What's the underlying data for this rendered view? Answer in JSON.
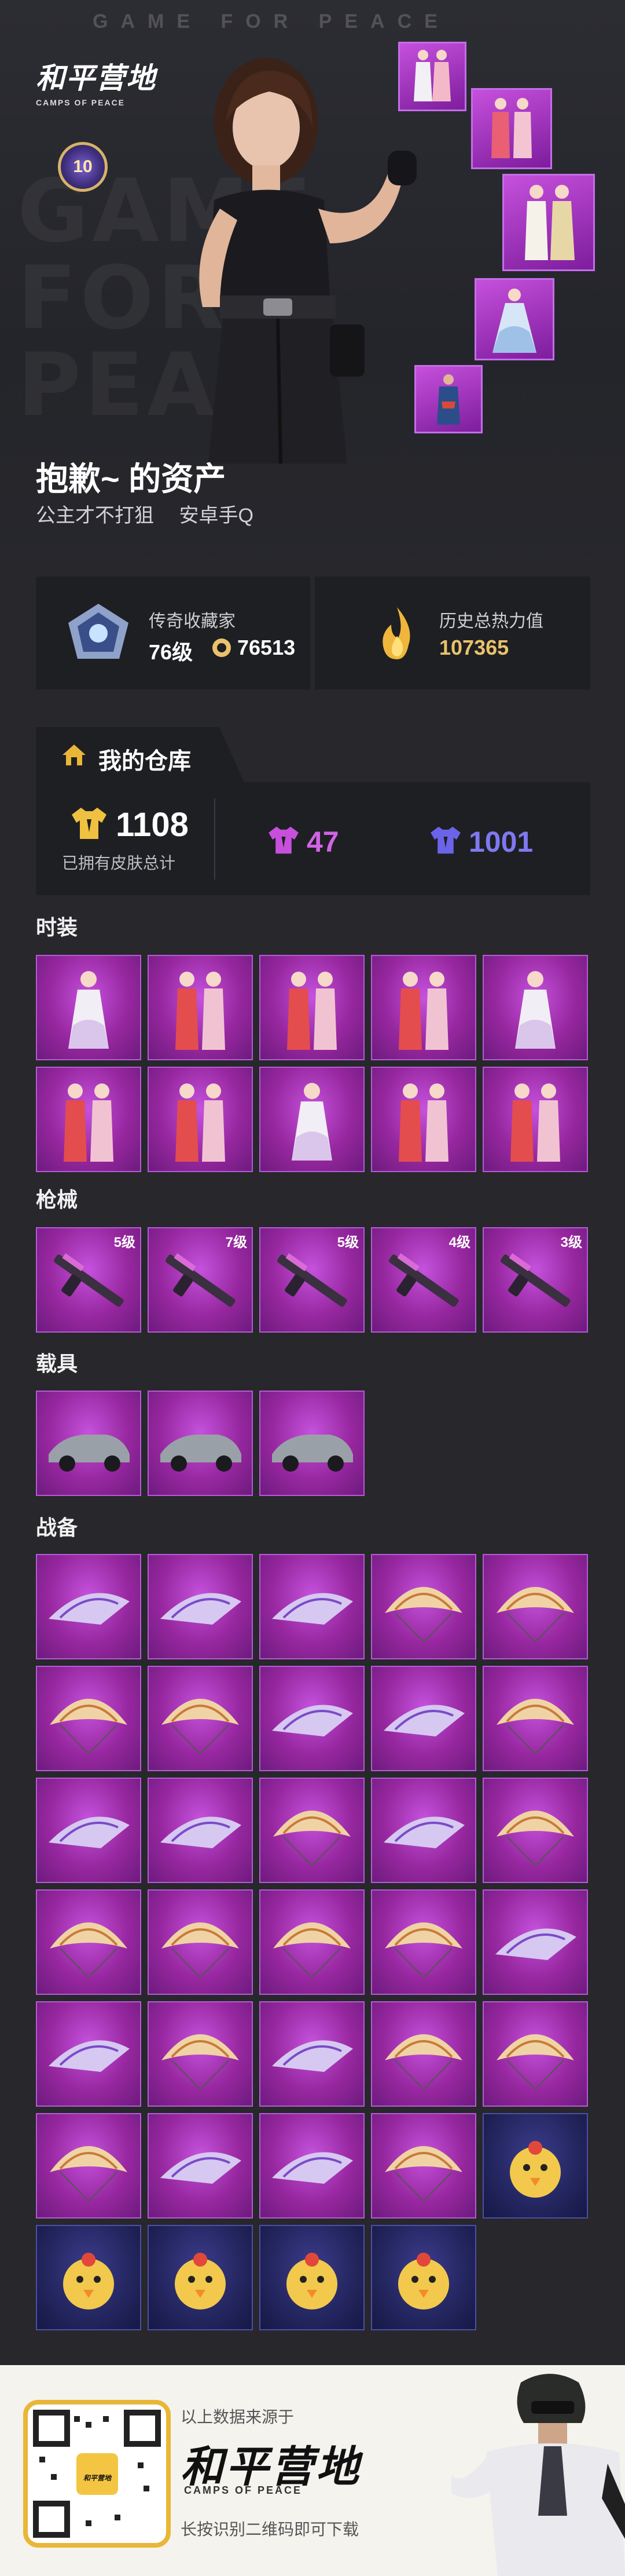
{
  "header": {
    "watermark_top": "GAME FOR PEACE",
    "watermark_lines": [
      "GAME",
      "FOR",
      "PEACE"
    ],
    "logo_cn": "和平营地",
    "logo_en": "CAMPS OF PEACE",
    "level_badge": "10"
  },
  "player": {
    "title": "抱歉~ 的资产",
    "tags": [
      "公主才不打狙",
      "安卓手Q"
    ]
  },
  "stats": {
    "collector": {
      "title": "传奇收藏家",
      "level": "76级",
      "score": "76513"
    },
    "heat": {
      "title": "历史总热力值",
      "value": "107365"
    }
  },
  "warehouse": {
    "tab_label": "我的仓库",
    "total": "1108",
    "total_caption": "已拥有皮肤总计",
    "legendary_count": "47",
    "epic_count": "1001"
  },
  "sections": {
    "fashion": "时装",
    "guns": "枪械",
    "vehicles": "载具",
    "gear": "战备"
  },
  "gun_levels": [
    "5级",
    "7级",
    "5级",
    "4级",
    "3级"
  ],
  "footer": {
    "source": "以上数据来源于",
    "brand": "和平营地",
    "brand_en": "CAMPS OF PEACE",
    "scan": "长按识别二维码即可下载",
    "qr_logo": "和平营地"
  },
  "colors": {
    "legendary": "#c650dc",
    "epic": "#3b3c8c",
    "gold": "#e9c26b"
  }
}
